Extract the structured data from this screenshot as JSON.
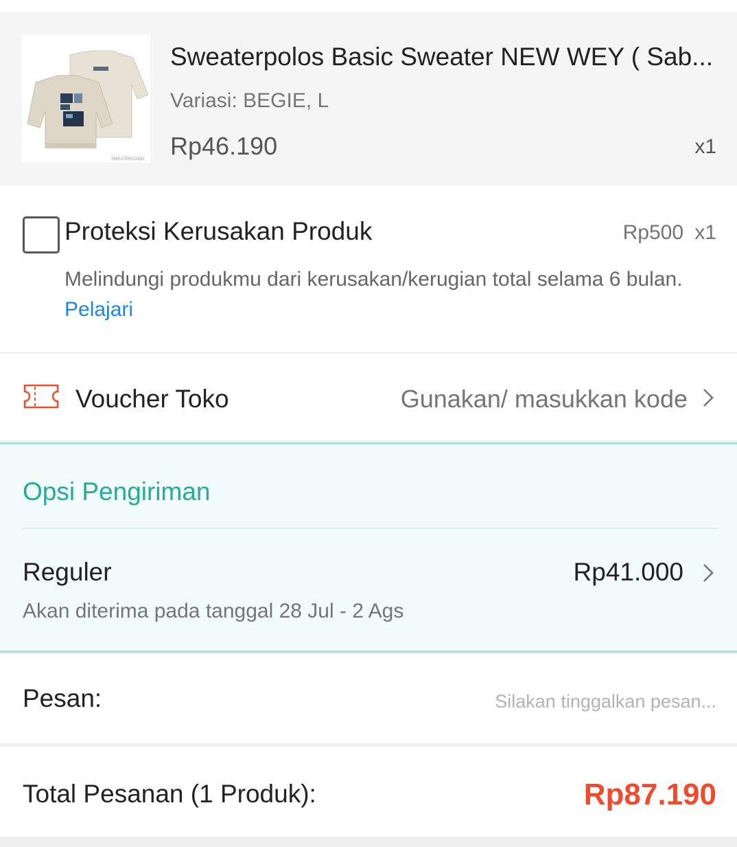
{
  "product": {
    "title": "Sweaterpolos Basic Sweater NEW WEY ( Sab...",
    "variant": "Variasi: BEGIE, L",
    "price": "Rp46.190",
    "quantity": "x1"
  },
  "protection": {
    "title": "Proteksi Kerusakan Produk",
    "price": "Rp500",
    "quantity": "x1",
    "description": "Melindungi produkmu dari kerusakan/kerugian total selama 6 bulan.",
    "link_label": "Pelajari",
    "checked": false
  },
  "voucher": {
    "label": "Voucher Toko",
    "action": "Gunakan/ masukkan kode",
    "icon": "ticket-icon"
  },
  "shipping": {
    "heading": "Opsi Pengiriman",
    "method": "Reguler",
    "price": "Rp41.000",
    "eta": "Akan diterima pada tanggal 28 Jul - 2 Ags"
  },
  "message": {
    "label": "Pesan:",
    "placeholder": "Silakan tinggalkan pesan...",
    "value": ""
  },
  "total": {
    "label": "Total Pesanan (1 Produk):",
    "value": "Rp87.190"
  },
  "colors": {
    "accent_orange": "#ee4d2d",
    "teal": "#26aa99",
    "link_blue": "#1a88e3",
    "voucher_red": "#ee4d2d"
  }
}
